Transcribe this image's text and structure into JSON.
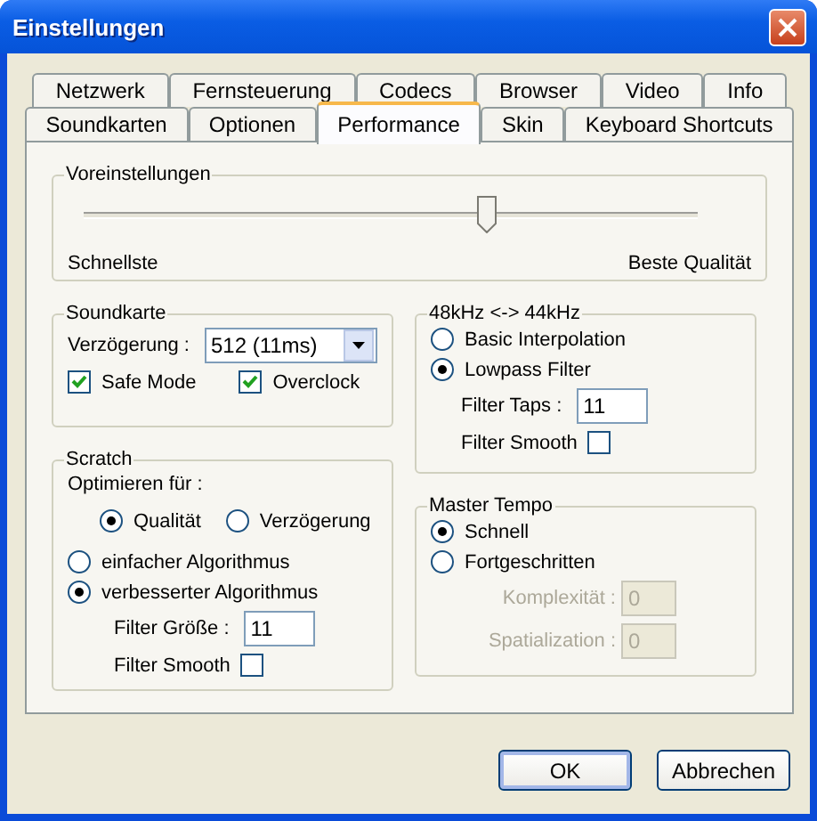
{
  "window": {
    "title": "Einstellungen"
  },
  "tabs": [
    [
      {
        "label": "Netzwerk",
        "selected": false
      },
      {
        "label": "Fernsteuerung",
        "selected": false
      },
      {
        "label": "Codecs",
        "selected": false
      },
      {
        "label": "Browser",
        "selected": false
      },
      {
        "label": "Video",
        "selected": false
      },
      {
        "label": "Info",
        "selected": false
      }
    ],
    [
      {
        "label": "Soundkarten",
        "selected": false
      },
      {
        "label": "Optionen",
        "selected": false
      },
      {
        "label": "Performance",
        "selected": true
      },
      {
        "label": "Skin",
        "selected": false
      },
      {
        "label": "Keyboard Shortcuts",
        "selected": false
      }
    ]
  ],
  "presets": {
    "title": "Voreinstellungen",
    "level": 0.66,
    "min_label": "Schnellste",
    "max_label": "Beste Qualität"
  },
  "soundcard": {
    "title": "Soundkarte",
    "latency_label": "Verzögerung :",
    "latency_value": "512 (11ms)",
    "checkboxes": [
      {
        "label": "Safe Mode",
        "checked": true
      },
      {
        "label": "Overclock",
        "checked": true
      }
    ]
  },
  "scratch": {
    "title": "Scratch",
    "optimize_label": "Optimieren für :",
    "optimize_options": [
      {
        "label": "Qualität",
        "selected": true
      },
      {
        "label": "Verzögerung",
        "selected": false
      }
    ],
    "algorithms": [
      {
        "label": "einfacher Algorithmus",
        "selected": false
      },
      {
        "label": "verbesserter Algorithmus",
        "selected": true
      }
    ],
    "filter_size_label": "Filter Größe :",
    "filter_size_value": "11",
    "filter_smooth": {
      "label": "Filter Smooth",
      "checked": false
    }
  },
  "resample": {
    "title": "48kHz <-> 44kHz",
    "options": [
      {
        "label": "Basic Interpolation",
        "selected": false
      },
      {
        "label": "Lowpass Filter",
        "selected": true
      }
    ],
    "filter_taps_label": "Filter Taps :",
    "filter_taps_value": "11",
    "filter_smooth": {
      "label": "Filter Smooth",
      "checked": false
    }
  },
  "master_tempo": {
    "title": "Master Tempo",
    "options": [
      {
        "label": "Schnell",
        "selected": true
      },
      {
        "label": "Fortgeschritten",
        "selected": false
      }
    ],
    "fields": [
      {
        "label": "Komplexität :",
        "value": "0",
        "disabled": true
      },
      {
        "label": "Spatialization :",
        "value": "0",
        "disabled": true
      }
    ]
  },
  "buttons": [
    {
      "label": "OK",
      "default": true
    },
    {
      "label": "Abbrechen",
      "default": false
    }
  ]
}
